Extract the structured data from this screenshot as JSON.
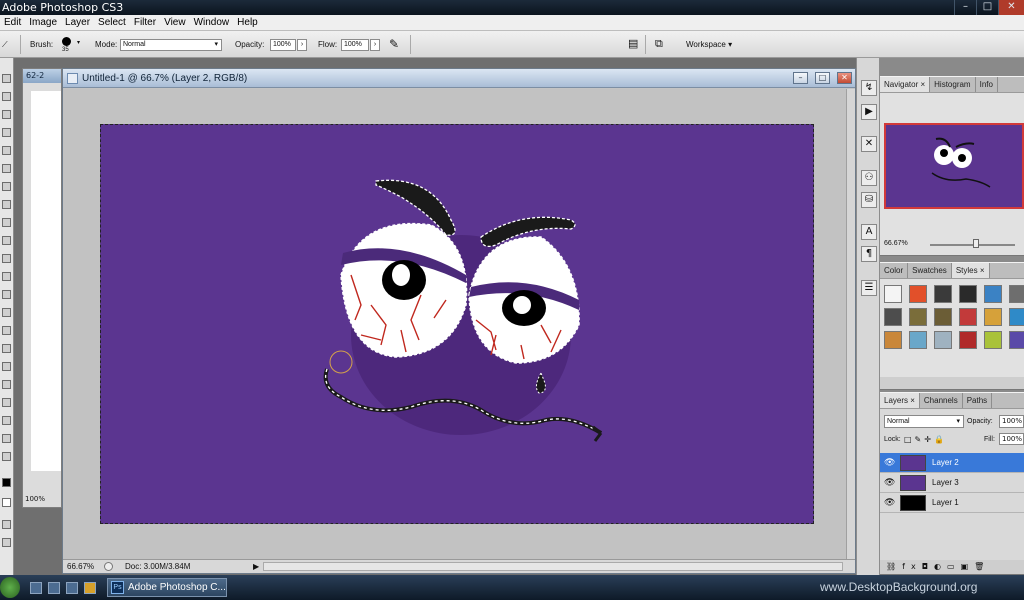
{
  "app": {
    "title": "Adobe Photoshop CS3",
    "window_controls": {
      "minimize": "–",
      "maximize": "□",
      "close": "✕"
    }
  },
  "menu": [
    "Edit",
    "Image",
    "Layer",
    "Select",
    "Filter",
    "View",
    "Window",
    "Help"
  ],
  "options_bar": {
    "brush_label": "Brush:",
    "brush_size": "35",
    "mode_label": "Mode:",
    "mode_value": "Normal",
    "opacity_label": "Opacity:",
    "opacity_value": "100%",
    "flow_label": "Flow:",
    "flow_value": "100%",
    "workspace_label": "Workspace ▾"
  },
  "bg_document": {
    "title": "62-2",
    "zoom": "100%"
  },
  "document": {
    "title": "Untitled-1 @ 66.7% (Layer 2, RGB/8)",
    "zoom": "66.67%",
    "doc_info": "Doc: 3.00M/3.84M",
    "canvas_color": "#5b3590"
  },
  "navigator": {
    "tabs": [
      "Navigator ×",
      "Histogram",
      "Info"
    ],
    "zoom": "66.67%"
  },
  "styles_panel": {
    "tabs": [
      "Color",
      "Swatches",
      "Styles ×"
    ],
    "swatches": [
      "#f4f4f4",
      "#e2502a",
      "#3a3a3a",
      "#2a2a2a",
      "#3b82c4",
      "#6e6e6e",
      "#4d4d4d",
      "#7a6d3a",
      "#6b5d36",
      "#c23a3a",
      "#d6a13a",
      "#2f8ac8",
      "#c9873a",
      "#6aa7c9",
      "#9fb2c0",
      "#b02a2a",
      "#a9c23a",
      "#5a4aa8"
    ]
  },
  "layers_panel": {
    "tabs": [
      "Layers ×",
      "Channels",
      "Paths"
    ],
    "blend_mode": "Normal",
    "opacity_label": "Opacity:",
    "opacity_value": "100%",
    "lock_label": "Lock:",
    "fill_label": "Fill:",
    "fill_value": "100%",
    "layers": [
      {
        "name": "Layer 2",
        "selected": true,
        "thumb": "#5b3590"
      },
      {
        "name": "Layer 3",
        "selected": false,
        "thumb": "#5b3590"
      },
      {
        "name": "Layer 1",
        "selected": false,
        "thumb": "#000000"
      }
    ]
  },
  "taskbar": {
    "active_app": "Adobe Photoshop C...",
    "watermark": "www.DesktopBackground.org"
  }
}
